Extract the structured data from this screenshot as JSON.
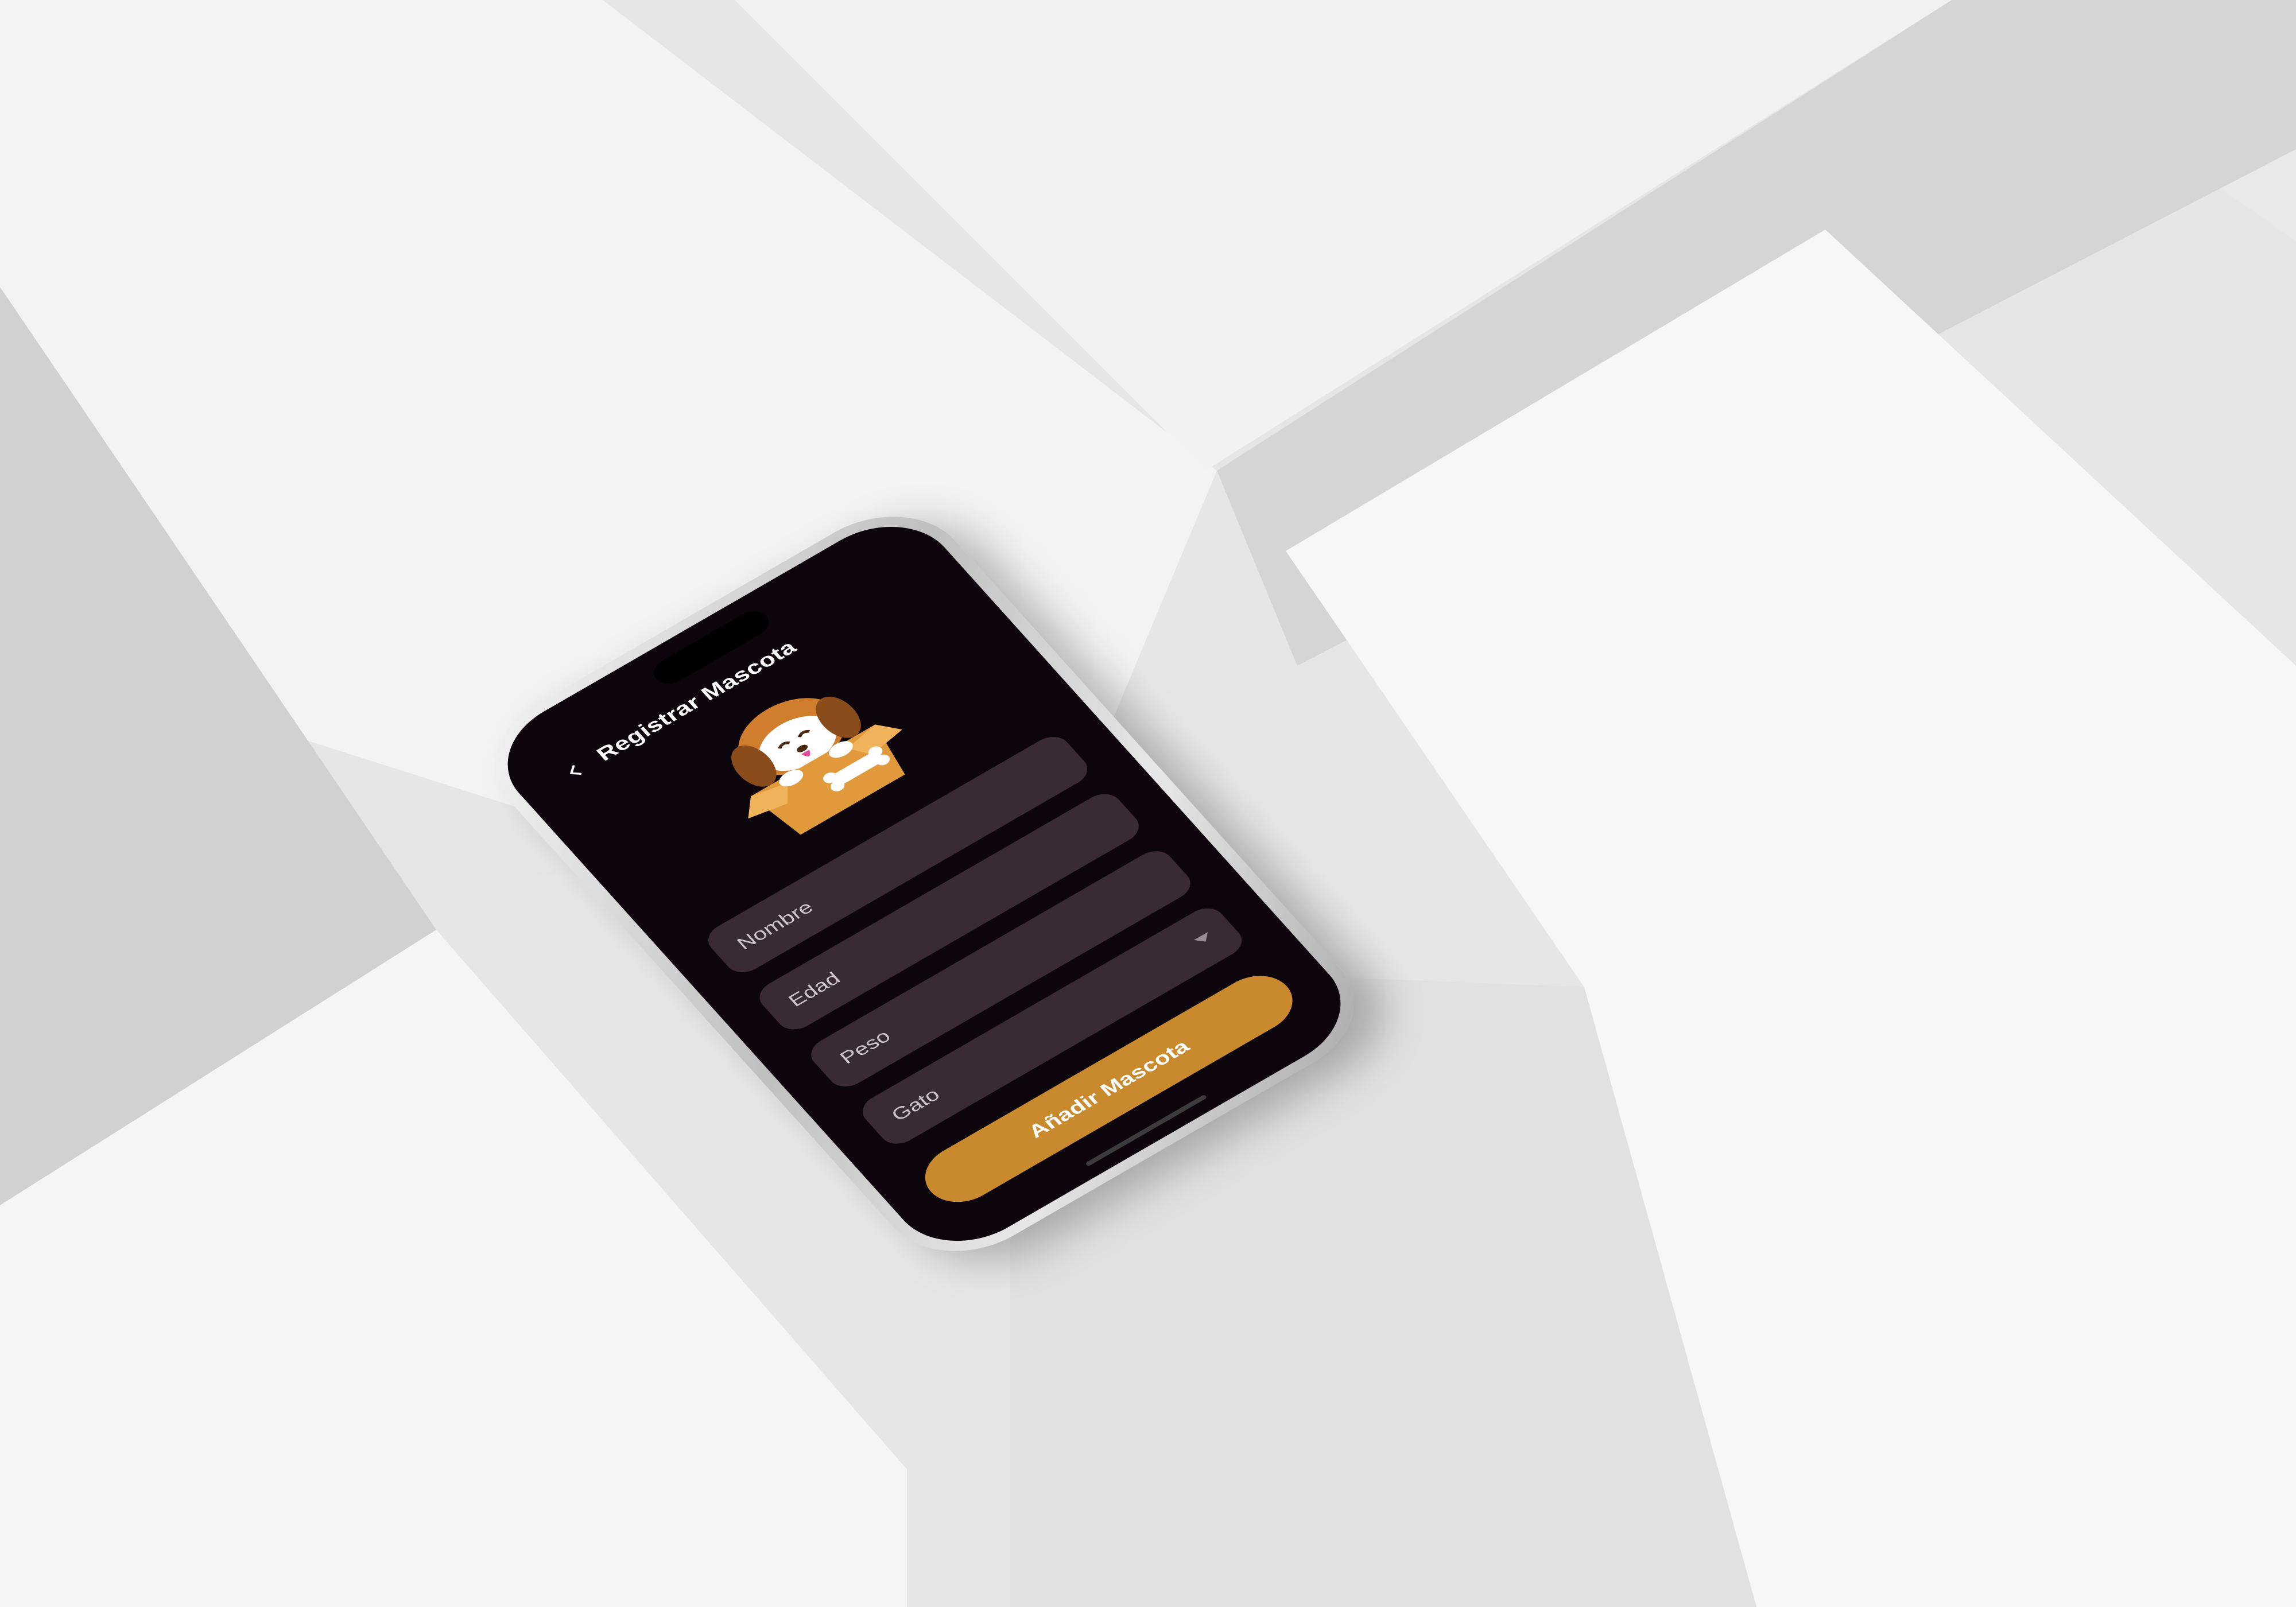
{
  "screen": {
    "title": "Registrar Mascota",
    "back_icon": "chevron-left-icon",
    "hero_image": "dog-in-box-illustration"
  },
  "form": {
    "fields": [
      {
        "label": "Nombre"
      },
      {
        "label": "Edad"
      },
      {
        "label": "Peso"
      },
      {
        "label": "Gato",
        "dropdown": true
      }
    ],
    "submit_label": "Añadir Mascota"
  },
  "colors": {
    "background": "#0c050b",
    "field": "#3a2a31",
    "accent": "#c98a2d"
  }
}
